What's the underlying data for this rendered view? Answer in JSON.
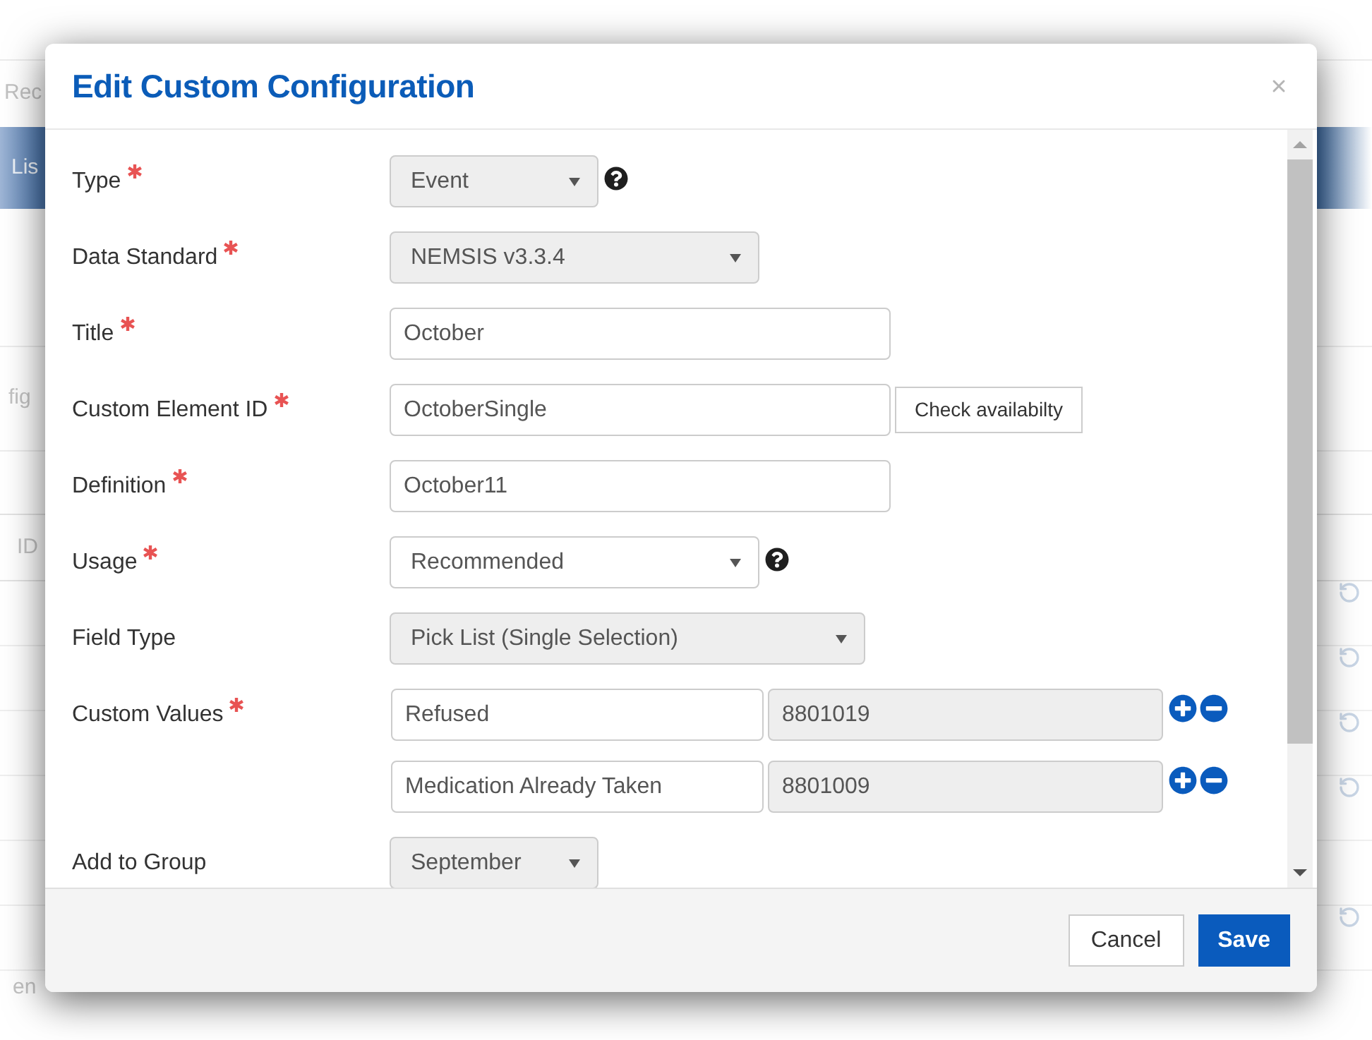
{
  "background_page": {
    "header_text": "Rec",
    "banner_text": "Lis",
    "section_text": "fig",
    "table_header_text": "ID",
    "table_rows": [
      {
        "action_icon": true
      },
      {
        "action_icon": true
      },
      {
        "action_icon": true
      },
      {
        "action_icon": true
      },
      {
        "action_icon": false
      },
      {
        "action_icon": true
      }
    ],
    "footer_text": "en"
  },
  "dialog": {
    "title": "Edit Custom Configuration",
    "fields": [
      {
        "label": "Type",
        "required": true,
        "kind": "select",
        "value": "Event",
        "disabled": true,
        "help": true
      },
      {
        "label": "Data Standard",
        "required": true,
        "kind": "select",
        "value": "NEMSIS v3.3.4",
        "disabled": true,
        "help": false
      },
      {
        "label": "Title",
        "required": true,
        "kind": "text",
        "value": "October",
        "help": false
      },
      {
        "label": "Custom Element ID",
        "required": true,
        "kind": "text",
        "value": "OctoberSingle",
        "action": "Check availabilty",
        "help": false
      },
      {
        "label": "Definition",
        "required": true,
        "kind": "text",
        "value": "October11",
        "help": false
      },
      {
        "label": "Usage",
        "required": true,
        "kind": "select",
        "value": "Recommended",
        "disabled": false,
        "help": true
      },
      {
        "label": "Field Type",
        "required": false,
        "kind": "select",
        "value": "Pick List (Single Selection)",
        "disabled": true,
        "help": false
      },
      {
        "label": "Custom Values",
        "required": true,
        "kind": "value_list",
        "help": false,
        "values": [
          {
            "text": "Refused",
            "code": "8801019",
            "code_disabled": true
          },
          {
            "text": "Medication Already Taken",
            "code": "8801009",
            "code_disabled": true
          }
        ]
      },
      {
        "label": "Add to Group",
        "required": false,
        "kind": "select",
        "value": "September",
        "disabled": true,
        "help": false
      }
    ],
    "buttons": [
      {
        "label": "Cancel",
        "kind": "secondary"
      },
      {
        "label": "Save",
        "kind": "primary"
      }
    ]
  }
}
